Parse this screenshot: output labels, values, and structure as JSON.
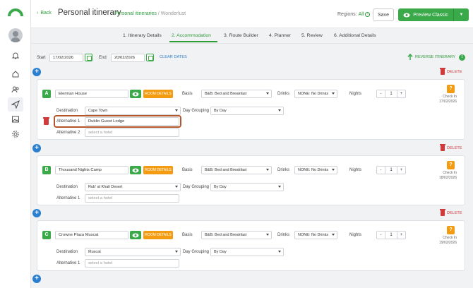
{
  "topbar": {
    "back_label": "Back",
    "title": "Personal itinerary",
    "breadcrumb_link": "Personal itineraries",
    "breadcrumb_sep": "/",
    "breadcrumb_current": "Wonderlust",
    "regions_label": "Regions:",
    "regions_value": "All",
    "save_label": "Save",
    "preview_label": "Preview Classic"
  },
  "steps": [
    {
      "label": "1. Itinerary Details"
    },
    {
      "label": "2. Accommodation"
    },
    {
      "label": "3. Route Builder"
    },
    {
      "label": "4. Planner"
    },
    {
      "label": "5. Review"
    },
    {
      "label": "6. Additional Details"
    }
  ],
  "dates": {
    "start_label": "Start",
    "start_value": "17/02/2026",
    "end_label": "End",
    "end_value": "20/02/2026",
    "clear_label": "CLEAR DATES",
    "reverse_label": "REVERSE ITINERARY"
  },
  "delete_label": "DELETE",
  "labels": {
    "basis": "Basis",
    "drinks": "Drinks",
    "nights": "Nights",
    "destination": "Destination",
    "day_grouping": "Day Grouping",
    "room_details": "ROOM DETAILS",
    "check_in": "Check In",
    "question": "?",
    "minus": "-",
    "plus": "+"
  },
  "stops": [
    {
      "letter": "A",
      "name": "Elerman House",
      "basis": "B&B: Bed and Breakfast",
      "drinks": "NONE: No Drinks",
      "nights": "1",
      "check_in_date": "17/02/2026",
      "destination": "Cape Town",
      "day_grouping": "By Day",
      "alternatives": [
        {
          "label": "Alternative 1",
          "value": "Dublin Guest Lodge",
          "placeholder": ""
        },
        {
          "label": "Alternative 2",
          "value": "",
          "placeholder": "select a hotel"
        }
      ]
    },
    {
      "letter": "B",
      "name": "Thousand Nights Camp",
      "basis": "B&B: Bed and Breakfast",
      "drinks": "NONE: No Drinks",
      "nights": "1",
      "check_in_date": "18/02/2026",
      "destination": "Rub' al Khali Desert",
      "day_grouping": "By Day",
      "alternatives": [
        {
          "label": "Alternative 1",
          "value": "",
          "placeholder": "select a hotel"
        }
      ]
    },
    {
      "letter": "C",
      "name": "Crowne Plaza Muscat",
      "basis": "B&B: Bed and Breakfast",
      "drinks": "NONE: No Drinks",
      "nights": "1",
      "check_in_date": "19/02/2026",
      "destination": "Muscat",
      "day_grouping": "By Day",
      "alternatives": [
        {
          "label": "Alternative 1",
          "value": "",
          "placeholder": "select a hotel"
        }
      ]
    }
  ],
  "colors": {
    "brand_green": "#3aa94a",
    "accent_orange": "#f39c12",
    "delete_red": "#d03a3a",
    "link_blue": "#2a7fd0",
    "highlight": "#b5562a"
  }
}
